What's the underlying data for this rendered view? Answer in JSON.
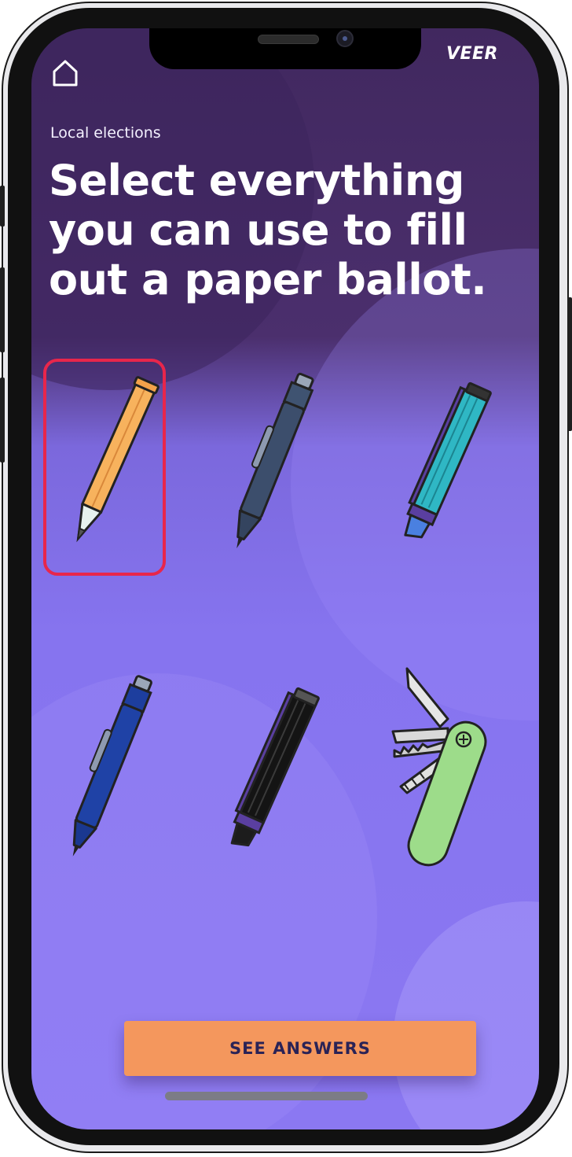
{
  "app": {
    "brand": "VEER"
  },
  "header": {
    "subtitle": "Local elections",
    "question": "Select everything you can use to fill out a paper ballot."
  },
  "options": [
    {
      "name": "pencil",
      "selected": true
    },
    {
      "name": "ballpoint-pen-grey",
      "selected": false
    },
    {
      "name": "highlighter",
      "selected": false
    },
    {
      "name": "ballpoint-pen-blue",
      "selected": false
    },
    {
      "name": "black-marker",
      "selected": false
    },
    {
      "name": "pocket-knife",
      "selected": false
    }
  ],
  "actions": {
    "see_answers_label": "SEE ANSWERS"
  },
  "colors": {
    "selection_border": "#e8264b",
    "cta_background": "#f4975d",
    "cta_text": "#2a2356"
  }
}
